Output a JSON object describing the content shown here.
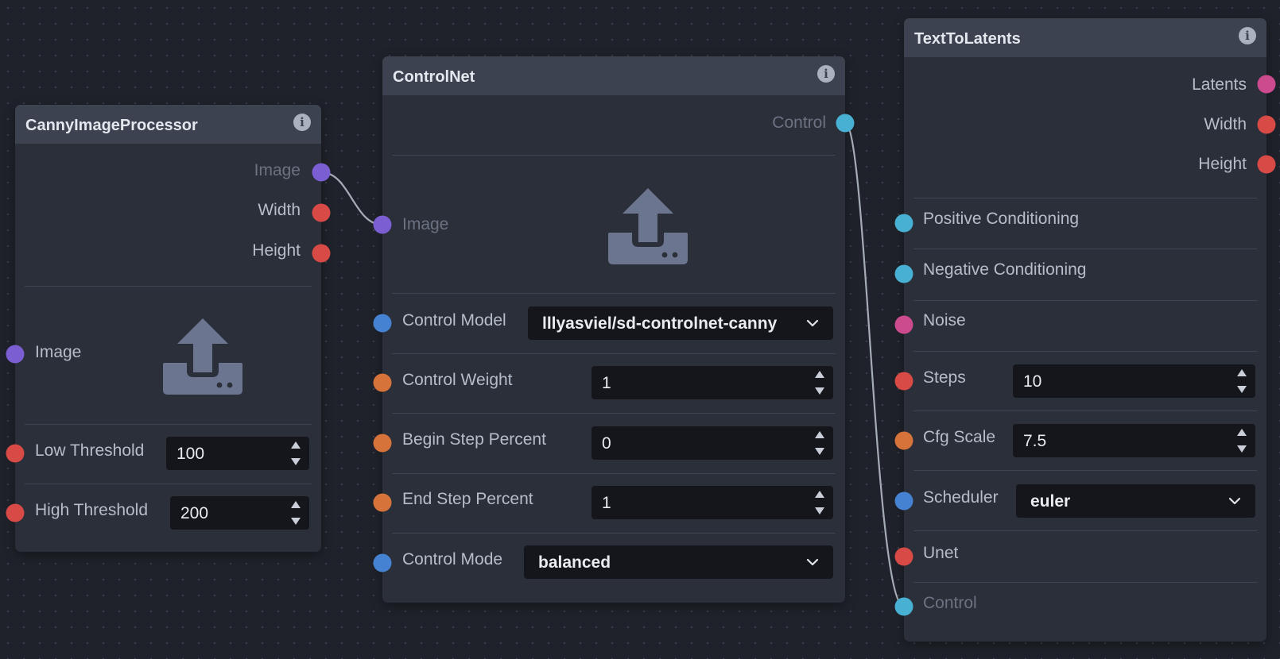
{
  "colors": {
    "canvas": "#1f222a",
    "node_body": "#2b2f39",
    "node_header": "#3d4250",
    "handle_image": "#7b5ed1",
    "handle_integer": "#d84a45",
    "handle_float": "#d5733a",
    "handle_conditioning": "#48b0d3",
    "handle_model": "#4582d1",
    "handle_noise": "#cc4a8e",
    "wire": "#a6acb6"
  },
  "canny": {
    "title": "CannyImageProcessor",
    "info_icon": "info-icon",
    "outputs": {
      "image": "Image",
      "width": "Width",
      "height": "Height"
    },
    "inputs": {
      "image": "Image",
      "image_icon": "upload-icon",
      "low_threshold_label": "Low Threshold",
      "low_threshold_value": "100",
      "high_threshold_label": "High Threshold",
      "high_threshold_value": "200"
    }
  },
  "controlnet": {
    "title": "ControlNet",
    "info_icon": "info-icon",
    "outputs": {
      "control": "Control"
    },
    "inputs": {
      "image": "Image",
      "image_icon": "upload-icon",
      "control_model_label": "Control Model",
      "control_model_value": "lllyasviel/sd-controlnet-canny",
      "control_weight_label": "Control Weight",
      "control_weight_value": "1",
      "begin_step_label": "Begin Step Percent",
      "begin_step_value": "0",
      "end_step_label": "End Step Percent",
      "end_step_value": "1",
      "control_mode_label": "Control Mode",
      "control_mode_value": "balanced"
    }
  },
  "t2l": {
    "title": "TextToLatents",
    "info_icon": "info-icon",
    "outputs": {
      "latents": "Latents",
      "width": "Width",
      "height": "Height"
    },
    "inputs": {
      "positive": "Positive Conditioning",
      "negative": "Negative Conditioning",
      "noise": "Noise",
      "steps_label": "Steps",
      "steps_value": "10",
      "cfg_label": "Cfg Scale",
      "cfg_value": "7.5",
      "scheduler_label": "Scheduler",
      "scheduler_value": "euler",
      "unet": "Unet",
      "control": "Control"
    }
  }
}
